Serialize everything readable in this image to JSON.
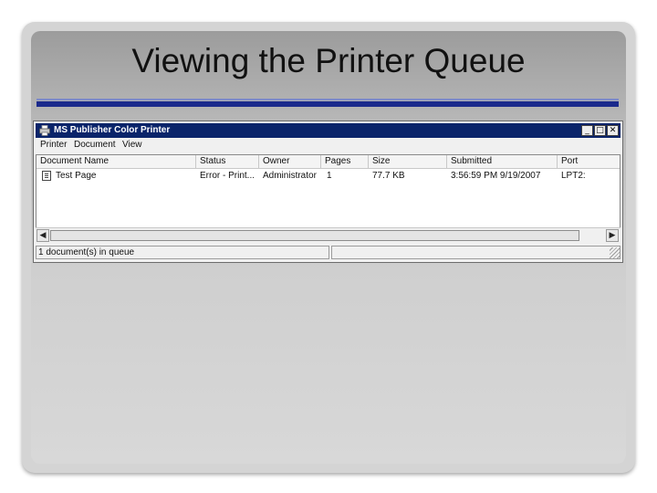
{
  "slide": {
    "title": "Viewing the Printer Queue"
  },
  "window": {
    "title": "MS Publisher Color Printer",
    "controls": {
      "minimize": "_",
      "maximize": "□",
      "close": "✕"
    },
    "menu": [
      "Printer",
      "Document",
      "View"
    ],
    "columns": [
      "Document Name",
      "Status",
      "Owner",
      "Pages",
      "Size",
      "Submitted",
      "Port"
    ],
    "rows": [
      {
        "document_name": "Test Page",
        "status": "Error - Print...",
        "owner": "Administrator",
        "pages": "1",
        "size": "77.7 KB",
        "submitted": "3:56:59 PM  9/19/2007",
        "port": "LPT2:"
      }
    ],
    "status_text": "1 document(s) in queue",
    "icons": {
      "app": "printer-icon",
      "row": "document-icon"
    }
  },
  "colors": {
    "titlebar": "#0a246a",
    "title_rule": "#1b2a8c"
  }
}
